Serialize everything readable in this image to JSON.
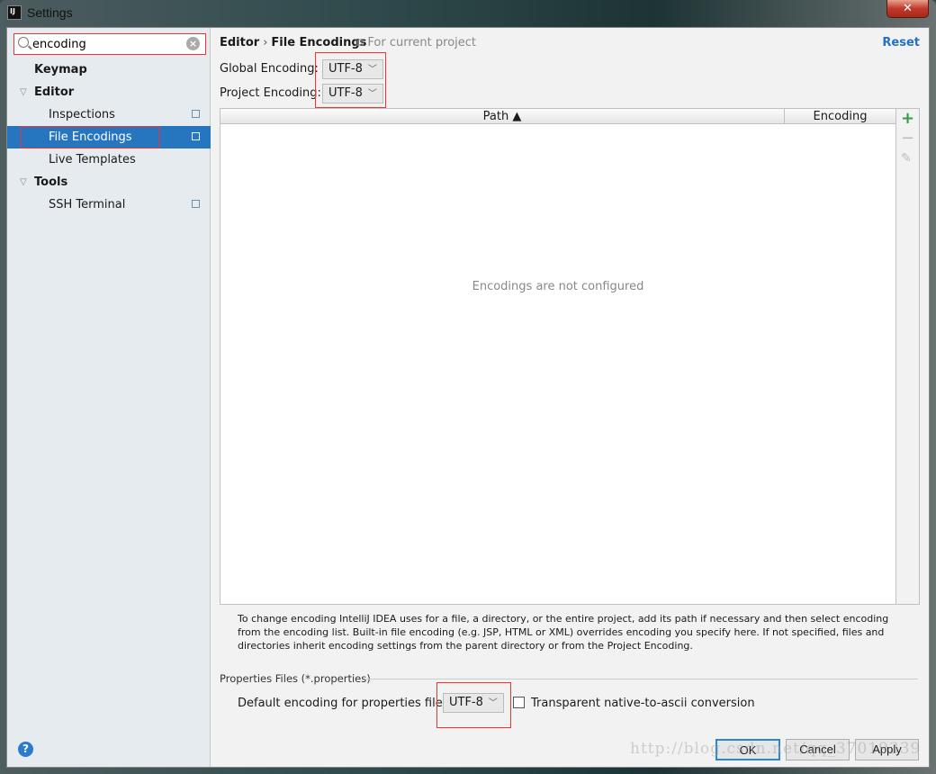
{
  "window": {
    "title": "Settings",
    "icon": "IJ",
    "close": "✕"
  },
  "search": {
    "value": "encoding"
  },
  "sidebar": {
    "items": [
      {
        "label": "Keymap",
        "bold": true
      },
      {
        "label": "Editor",
        "bold": true,
        "expanded": true
      },
      {
        "label": "Inspections"
      },
      {
        "label": "File Encodings",
        "selected": true
      },
      {
        "label": "Live Templates"
      },
      {
        "label": "Tools",
        "bold": true,
        "expanded": true
      },
      {
        "label": "SSH Terminal"
      }
    ]
  },
  "header": {
    "crumb1": "Editor",
    "sep": "›",
    "crumb2": "File Encodings",
    "scope": "For current project",
    "reset": "Reset"
  },
  "encoding": {
    "global_label": "Global Encoding:",
    "global_value": "UTF-8",
    "project_label": "Project Encoding:",
    "project_value": "UTF-8"
  },
  "table": {
    "columns": [
      "Path ▲",
      "Encoding"
    ],
    "empty": "Encodings are not configured"
  },
  "toolbar": {
    "add": "+",
    "remove": "−",
    "edit": "✎"
  },
  "help_text": "To change encoding IntelliJ IDEA uses for a file, a directory, or the entire project, add its path if necessary and then select encoding from the encoding list. Built-in file encoding (e.g. JSP, HTML or XML) overrides encoding you specify here. If not specified, files and directories inherit encoding settings from the parent directory or from the Project Encoding.",
  "properties": {
    "section": "Properties Files (*.properties)",
    "default_label": "Default encoding for properties files:",
    "default_value": "UTF-8",
    "transparent_label": "Transparent native-to-ascii conversion",
    "transparent_checked": false
  },
  "buttons": {
    "help": "?",
    "ok": "OK",
    "cancel": "Cancel",
    "apply": "Apply"
  },
  "watermark": "http://blog.csdn.net/qq_37019339",
  "colors": {
    "accent": "#2675bf",
    "highlight": "#ee3333",
    "add": "#2e9e3e"
  }
}
